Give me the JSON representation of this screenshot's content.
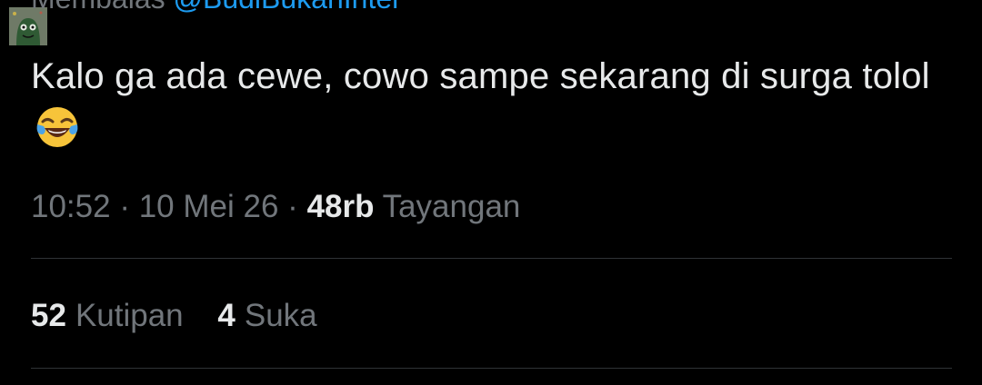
{
  "reply": {
    "prefix": "Membalas",
    "handle": "@BudiBukanIntel"
  },
  "avatar": {
    "icon": "green-character-avatar",
    "bg_color": "#5d6b56"
  },
  "tweet": {
    "text": "Kalo ga ada cewe, cowo sampe sekarang di surga tolol",
    "emoji": "face-with-tears-of-joy"
  },
  "meta": {
    "time": "10:52",
    "date": "10 Mei 26",
    "views_count": "48rb",
    "views_label": "Tayangan"
  },
  "stats": {
    "quotes_count": "52",
    "quotes_label": "Kutipan",
    "likes_count": "4",
    "likes_label": "Suka"
  },
  "colors": {
    "background": "#000000",
    "text_primary": "#e7e9ea",
    "text_secondary": "#71767b",
    "link": "#1d9bf0",
    "divider": "#2f3336"
  }
}
